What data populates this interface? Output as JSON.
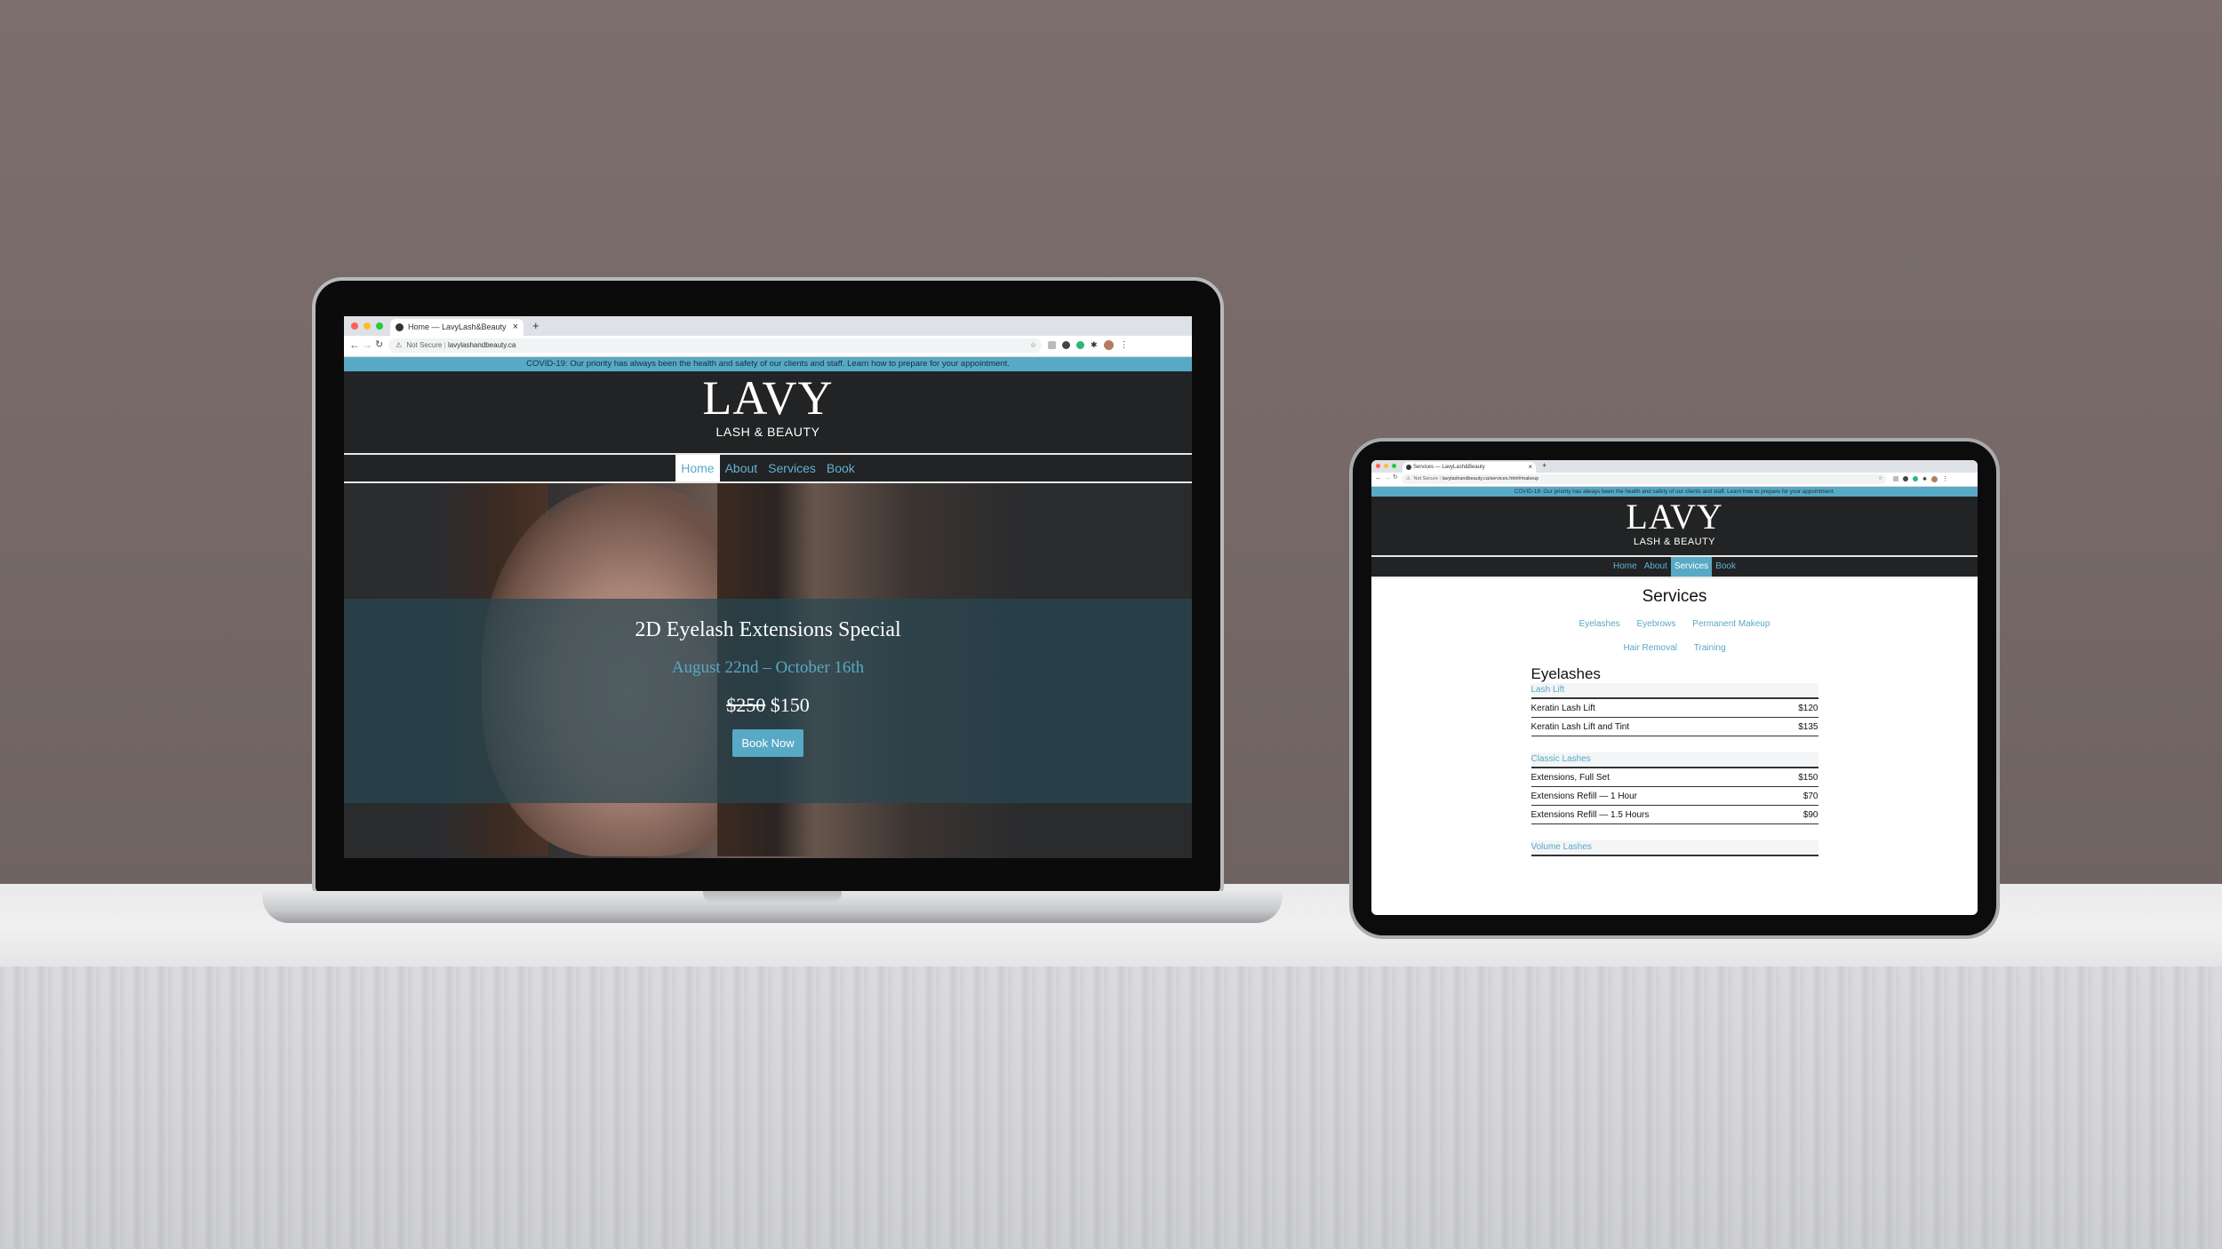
{
  "laptop": {
    "browser": {
      "tab_title": "Home — LavyLash&Beauty",
      "close_glyph": "×",
      "new_tab_glyph": "+",
      "not_secure": "Not Secure",
      "url": "lavylashandbeauty.ca"
    },
    "covid_banner": "COVID-19: Our priority has always been the health and safety of our clients and staff. Learn how to prepare for your appointment.",
    "logo": "LAVY",
    "tagline": "LASH & BEAUTY",
    "nav": [
      "Home",
      "About",
      "Services",
      "Book"
    ],
    "nav_active": "Home",
    "hero": {
      "title": "2D Eyelash Extensions Special",
      "dates": "August 22nd – October 16th",
      "old_price": "$250",
      "new_price": "$150",
      "button": "Book Now"
    }
  },
  "tablet": {
    "browser": {
      "tab_title": "Services — LavyLash&Beauty",
      "close_glyph": "×",
      "new_tab_glyph": "+",
      "not_secure": "Not Secure",
      "url": "lavylashandbeauty.ca/services.html#makeup"
    },
    "covid_banner": "COVID-19: Our priority has always been the health and safety of our clients and staff. Learn how to prepare for your appointment.",
    "logo": "LAVY",
    "tagline": "LASH & BEAUTY",
    "nav": [
      "Home",
      "About",
      "Services",
      "Book"
    ],
    "nav_active": "Services",
    "page_title": "Services",
    "category_links_row1": [
      "Eyelashes",
      "Eyebrows",
      "Permanent Makeup"
    ],
    "category_links_row2": [
      "Hair Removal",
      "Training"
    ],
    "section_title": "Eyelashes",
    "groups": [
      {
        "name": "Lash Lift",
        "items": [
          {
            "name": "Keratin Lash Lift",
            "price": "$120"
          },
          {
            "name": "Keratin Lash Lift and Tint",
            "price": "$135"
          }
        ]
      },
      {
        "name": "Classic Lashes",
        "items": [
          {
            "name": "Extensions, Full Set",
            "price": "$150"
          },
          {
            "name": "Extensions Refill — 1 Hour",
            "price": "$70"
          },
          {
            "name": "Extensions Refill — 1.5 Hours",
            "price": "$90"
          }
        ]
      },
      {
        "name": "Volume Lashes",
        "items": []
      }
    ]
  },
  "colors": {
    "accent": "#58a9c5",
    "header_bg": "#222324",
    "wall": "#776a68"
  }
}
